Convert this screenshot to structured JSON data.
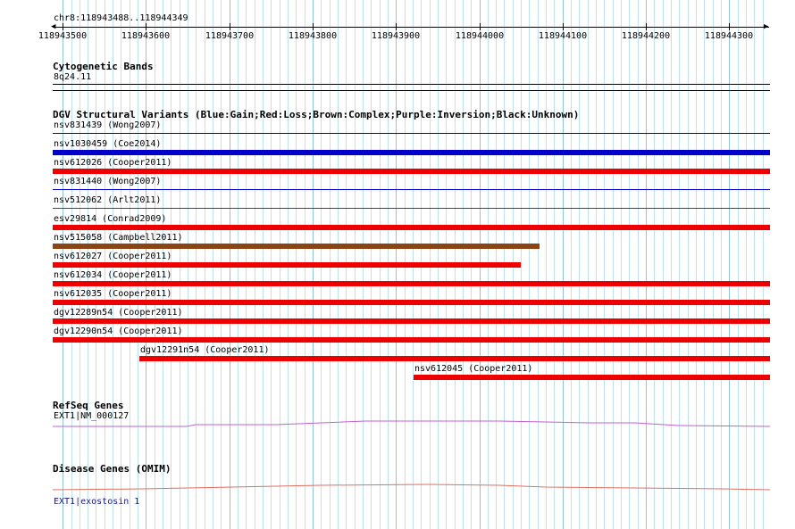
{
  "colors": {
    "grid_minor": "#bfe3ee",
    "grid_major": "#8fc7d9",
    "gain": "#0000cc",
    "loss": "#ee0000",
    "complex": "#8b4513",
    "refseq_line": "#c060d0",
    "omim_line": "#e07060",
    "link": "#1a1a8c"
  },
  "ruler": {
    "position_label": "chr8:118943488..118944349",
    "tick_labels": [
      "118943500",
      "118943600",
      "118943700",
      "118943800",
      "118943900",
      "118944000",
      "118944100",
      "118944200",
      "118944300"
    ]
  },
  "cytoband": {
    "title": "Cytogenetic Bands",
    "band_label": "8q24.11"
  },
  "dgv": {
    "title": "DGV Structural Variants (Blue:Gain;Red:Loss;Brown:Complex;Purple:Inversion;Black:Unknown)",
    "variants": [
      {
        "label": "nsv831439 (Wong2007)",
        "type": "gain",
        "start": 118943488,
        "end": 118944349,
        "thickness": "thin"
      },
      {
        "label": "nsv1030459 (Coe2014)",
        "type": "gain",
        "start": 118943488,
        "end": 118944349,
        "thickness": "thick"
      },
      {
        "label": "nsv612026 (Cooper2011)",
        "type": "loss",
        "start": 118943488,
        "end": 118944349,
        "thickness": "thick"
      },
      {
        "label": "nsv831440 (Wong2007)",
        "type": "gain",
        "start": 118943488,
        "end": 118944349,
        "thickness": "thin"
      },
      {
        "label": "nsv512062 (Arlt2011)",
        "type": "loss",
        "start": 118943488,
        "end": 118944349,
        "thickness": "thin"
      },
      {
        "label": "esv29814 (Conrad2009)",
        "type": "loss",
        "start": 118943488,
        "end": 118944349,
        "thickness": "thick"
      },
      {
        "label": "nsv515058 (Campbell2011)",
        "type": "complex",
        "start": 118943488,
        "end": 118944072,
        "thickness": "thick"
      },
      {
        "label": "nsv612027 (Cooper2011)",
        "type": "loss",
        "start": 118943488,
        "end": 118944050,
        "thickness": "thick"
      },
      {
        "label": "nsv612034 (Cooper2011)",
        "type": "loss",
        "start": 118943488,
        "end": 118944349,
        "thickness": "thick"
      },
      {
        "label": "nsv612035 (Cooper2011)",
        "type": "loss",
        "start": 118943488,
        "end": 118944349,
        "thickness": "thick"
      },
      {
        "label": "dgv12289n54 (Cooper2011)",
        "type": "loss",
        "start": 118943488,
        "end": 118944349,
        "thickness": "thick"
      },
      {
        "label": "dgv12290n54 (Cooper2011)",
        "type": "loss",
        "start": 118943488,
        "end": 118944349,
        "thickness": "thick"
      },
      {
        "label": "dgv12291n54 (Cooper2011)",
        "type": "loss",
        "start": 118943592,
        "end": 118944349,
        "thickness": "thick"
      },
      {
        "label": "nsv612045 (Cooper2011)",
        "type": "loss",
        "start": 118943921,
        "end": 118944349,
        "thickness": "thick"
      }
    ]
  },
  "refseq": {
    "title": "RefSeq Genes",
    "gene_label": "EXT1|NM_000127"
  },
  "omim": {
    "title": "Disease Genes (OMIM)",
    "gene_label": "EXT1|exostosin 1"
  }
}
